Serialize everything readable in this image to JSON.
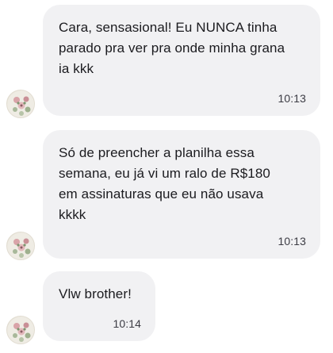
{
  "messages": [
    {
      "text": "Cara, sensasional! Eu NUNCA tinha\nparado pra ver pra onde minha grana\nia kkk",
      "time": "10:13",
      "avatar_icon": "floral-avatar-icon"
    },
    {
      "text": "Só de preencher a planilha essa\nsemana, eu já vi um ralo de R$180\nem assinaturas que eu não usava\nkkkk",
      "time": "10:13",
      "avatar_icon": "floral-avatar-icon"
    },
    {
      "text": "Vlw brother!",
      "time": "10:14",
      "avatar_icon": "floral-avatar-icon"
    }
  ],
  "colors": {
    "bubble_background": "#f1f1f3",
    "text": "#1b1b1f",
    "timestamp": "#3c3c44",
    "page_background": "#ffffff"
  }
}
